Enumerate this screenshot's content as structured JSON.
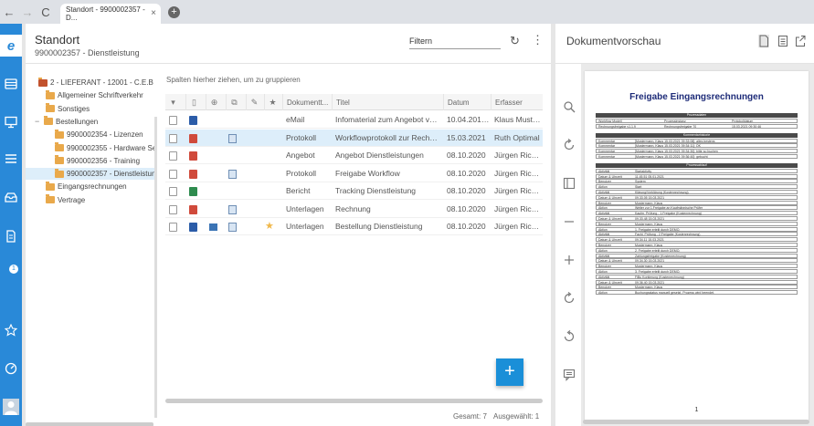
{
  "browser": {
    "tab_title": "Standort - 9900002357 - D...",
    "tab_close": "×",
    "back": "←",
    "forward": "→",
    "reload": "C",
    "new_tab": "+"
  },
  "app": {
    "logo": "e"
  },
  "main": {
    "title": "Standort",
    "subtitle": "9900002357 - Dienstleistung",
    "filter_label": "Filtern",
    "refresh": "↻",
    "more": "⋮"
  },
  "tree": {
    "items": [
      {
        "label": "2 - LIEFERANT - 12001 - C.E.B Berli",
        "indent": 14,
        "toggle": "",
        "selected": false
      },
      {
        "label": "Allgemeiner Schriftverkehr",
        "indent": 22,
        "toggle": "",
        "selected": false
      },
      {
        "label": "Sonstiges",
        "indent": 22,
        "toggle": "",
        "selected": false
      },
      {
        "label": "Bestellungen",
        "indent": 10,
        "toggle": "−",
        "selected": false
      },
      {
        "label": "9900002354 - Lizenzen",
        "indent": 32,
        "toggle": "",
        "selected": false
      },
      {
        "label": "9900002355 - Hardware Serv",
        "indent": 32,
        "toggle": "",
        "selected": false
      },
      {
        "label": "9900002356 - Training",
        "indent": 32,
        "toggle": "",
        "selected": false
      },
      {
        "label": "9900002357 - Dienstleistung",
        "indent": 32,
        "toggle": "",
        "selected": true
      },
      {
        "label": "Eingangsrechnungen",
        "indent": 22,
        "toggle": "",
        "selected": false
      },
      {
        "label": "Vertrage",
        "indent": 22,
        "toggle": "",
        "selected": false
      }
    ]
  },
  "grid": {
    "group_hint": "Spalten hierher ziehen, um zu gruppieren",
    "header_icons": [
      "▾",
      "▯",
      "⊕",
      "⧉",
      "✎",
      "★"
    ],
    "columns": [
      "Dokumentt...",
      "Titel",
      "Datum",
      "Erfasser"
    ],
    "rows": [
      {
        "type": "eMail",
        "title": "Infomaterial zum Angebot von ...",
        "date": "10.04.2019 ...",
        "author": "Klaus Muster...",
        "file": "word",
        "linked": false,
        "workflow": false,
        "starred": false,
        "selected": false
      },
      {
        "type": "Protokoll",
        "title": "Workflowprotokoll zur Rechnun...",
        "date": "15.03.2021",
        "author": "Ruth Optimal",
        "file": "pdf",
        "linked": true,
        "workflow": false,
        "starred": false,
        "selected": true
      },
      {
        "type": "Angebot",
        "title": "Angebot Dienstleistungen",
        "date": "08.10.2020",
        "author": "Jürgen Richter",
        "file": "pdf",
        "linked": false,
        "workflow": false,
        "starred": false,
        "selected": false
      },
      {
        "type": "Protokoll",
        "title": "Freigabe Workflow",
        "date": "08.10.2020",
        "author": "Jürgen Richter",
        "file": "pdf",
        "linked": true,
        "workflow": false,
        "starred": false,
        "selected": false
      },
      {
        "type": "Bericht",
        "title": "Tracking Dienstleistung",
        "date": "08.10.2020",
        "author": "Jürgen Richter",
        "file": "excel",
        "linked": false,
        "workflow": false,
        "starred": false,
        "selected": false
      },
      {
        "type": "Unterlagen",
        "title": "Rechnung",
        "date": "08.10.2020",
        "author": "Jürgen Richter",
        "file": "pdf",
        "linked": true,
        "workflow": false,
        "starred": false,
        "selected": false
      },
      {
        "type": "Unterlagen",
        "title": "Bestellung Dienstleistung",
        "date": "08.10.2020",
        "author": "Jürgen Richter",
        "file": "word",
        "linked": true,
        "workflow": true,
        "starred": true,
        "selected": false
      }
    ],
    "total": "Gesamt: 7",
    "selected": "Ausgewählt: 1",
    "fab": "+"
  },
  "preview": {
    "title": "Dokumentvorschau",
    "doc_title": "Freigabe Eingangsrechnungen",
    "page_number": "1",
    "sections": [
      {
        "heading": "Prozessdaten",
        "rows": [
          [
            "Workflow Modell",
            "Prozessinstanz",
            "Protokolldatum"
          ],
          [
            "Rechnungsfreigabe v1.1.9",
            "Rechnungsfreigabe 70",
            "15.03.2021 09:30:46"
          ]
        ]
      },
      {
        "heading": "Kommentarhistorie",
        "rows": [
          [
            "Kommentar",
            "[Mustermann, Klaus 15.03.2021 09:33:08]: alles bestens"
          ],
          [
            "Kommentar",
            "[Mustermann, Klaus 15.03.2021 09:34:11]: OK"
          ],
          [
            "Kommentar",
            "[Mustermann, Klaus 15.03.2021 09:34:30]: bitte so buchen"
          ],
          [
            "Kommentar",
            "[Mustermann, Klaus 15.03.2021 09:36:40]: gebucht"
          ]
        ]
      },
      {
        "heading": "Prozessablauf",
        "rows": [
          [
            "Aktivität",
            "Startaktivity"
          ],
          [
            "Datum & Uhrzeit",
            "11.45.51 05.01.2021"
          ],
          [
            "Benutzer",
            "System"
          ],
          [
            "Aktion",
            "Start"
          ],
          [
            "Aktivität",
            "Klärung/Vorklärung (Kostenrechnung)"
          ],
          [
            "Datum & Uhrzeit",
            "09.33.05 15.03.2021"
          ],
          [
            "Benutzer",
            "Mustermann, Klaus"
          ],
          [
            "Aktion",
            "Weiter zur 1.Freigabe an Kaufmännische Prüfer"
          ],
          [
            "Aktivität",
            "Kaufm. Prüfung - 1.Freigabe (Kostenrechnung)"
          ],
          [
            "Datum & Uhrzeit",
            "09.33.48 15.03.2021"
          ],
          [
            "Benutzer",
            "Mustermann, Klaus"
          ],
          [
            "Aktion",
            "1. Freigabe erteilt durch DEMO."
          ],
          [
            "Aktivität",
            "Fachl. Prüfung - 2.Freigabe (Kostenrechnung)"
          ],
          [
            "Datum & Uhrzeit",
            "09.34.11 15.03.2021"
          ],
          [
            "Benutzer",
            "Mustermann, Klaus"
          ],
          [
            "Aktion",
            "2. Freigabe erteilt durch DEMO."
          ],
          [
            "Aktivität",
            "Zahlungsfreigabe (Kostenrechnung)"
          ],
          [
            "Datum & Uhrzeit",
            "09.34.30 15.03.2021"
          ],
          [
            "Benutzer",
            "Mustermann, Klaus"
          ],
          [
            "Aktion",
            "3. Freigabe erteilt durch DEMO."
          ],
          [
            "Aktivität",
            "FiBu Kontierung (Kostenrechnung)"
          ],
          [
            "Datum & Uhrzeit",
            "09.36.40 15.03.2021"
          ],
          [
            "Benutzer",
            "Mustermann, Klaus"
          ],
          [
            "Aktion",
            "Buchungsstatus manuell gesetzt, Prozess wird beendet."
          ]
        ]
      }
    ]
  },
  "sidebar": {
    "badge_count": "1"
  },
  "colors": {
    "brand": "#2989d8",
    "selected_row": "#ddeefa",
    "fab": "#1a8fd8",
    "doc_title": "#1d2b78"
  }
}
